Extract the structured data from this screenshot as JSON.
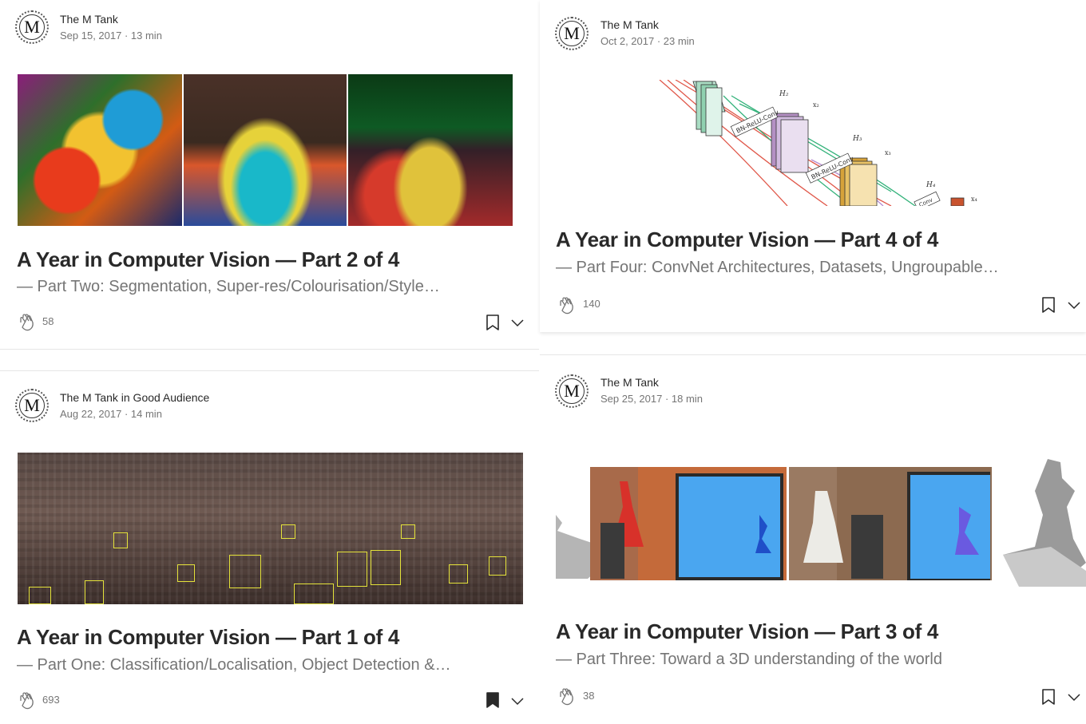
{
  "articles": [
    {
      "author": "The M Tank",
      "avatar_letter": "M",
      "date": "Sep 15, 2017",
      "read_time": "13 min",
      "meta": "Sep 15, 2017 · 13 min",
      "title": "A Year in Computer Vision — Part 2 of 4",
      "subtitle": "— Part Two: Segmentation, Super-res/Colourisation/Style…",
      "claps": "58",
      "bookmarked": false
    },
    {
      "author": "The M Tank",
      "avatar_letter": "M",
      "date": "Oct 2, 2017",
      "read_time": "23 min",
      "meta": "Oct 2, 2017 · 23 min",
      "title": "A Year in Computer Vision — Part 4 of 4",
      "subtitle": "— Part Four: ConvNet Architectures, Datasets, Ungroupable…",
      "claps": "140",
      "bookmarked": false
    },
    {
      "author": "The M Tank in Good Audience",
      "avatar_letter": "M",
      "date": "Aug 22, 2017",
      "read_time": "14 min",
      "meta": "Aug 22, 2017 · 14 min",
      "title": "A Year in Computer Vision — Part 1 of 4",
      "subtitle": "— Part One: Classification/Localisation, Object Detection &…",
      "claps": "693",
      "bookmarked": true
    },
    {
      "author": "The M Tank",
      "avatar_letter": "M",
      "date": "Sep 25, 2017",
      "read_time": "18 min",
      "meta": "Sep 25, 2017 · 18 min",
      "title": "A Year in Computer Vision — Part 3 of 4",
      "subtitle": "— Part Three: Toward a 3D understanding of the world",
      "claps": "38",
      "bookmarked": false
    }
  ],
  "diagram_labels": {
    "h2": "H₂",
    "x2": "x₂",
    "h3": "H₃",
    "x3": "x₃",
    "h4": "H₄",
    "x4": "x₄",
    "layer_a": "BN-ReLU-Conv",
    "layer_b": "BN-ReLU-Conv",
    "layer_c": "Conv"
  },
  "colors": {
    "title": "#292929",
    "meta": "#757575",
    "accent_yellow": "#e4e23a"
  }
}
